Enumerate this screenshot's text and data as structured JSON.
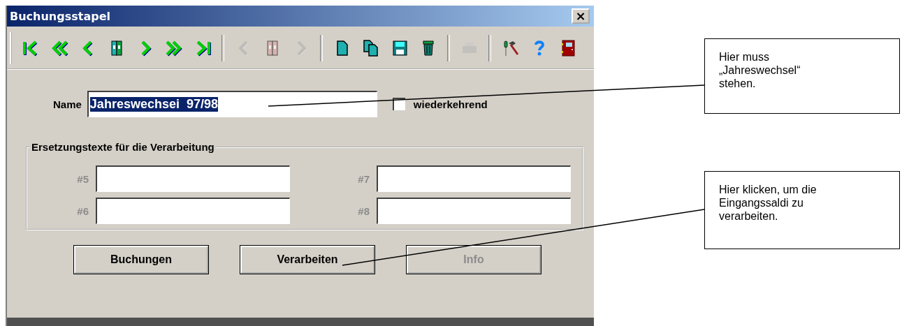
{
  "window": {
    "title": "Buchungsstapel",
    "close": "×"
  },
  "toolbar": [
    {
      "items": [
        {
          "kind": "first",
          "disabled": false
        },
        {
          "kind": "fast-back",
          "disabled": false
        },
        {
          "kind": "back",
          "disabled": false
        },
        {
          "kind": "binder",
          "disabled": false
        },
        {
          "kind": "forward",
          "disabled": false
        },
        {
          "kind": "fast-forward",
          "disabled": false
        },
        {
          "kind": "last",
          "disabled": false
        }
      ]
    },
    {
      "items": [
        {
          "kind": "back",
          "disabled": true
        },
        {
          "kind": "binder",
          "disabled": true
        },
        {
          "kind": "forward",
          "disabled": true
        }
      ]
    },
    {
      "items": [
        {
          "kind": "new",
          "disabled": false
        },
        {
          "kind": "copy",
          "disabled": false
        },
        {
          "kind": "save",
          "disabled": false
        },
        {
          "kind": "trash",
          "disabled": false
        }
      ]
    },
    {
      "items": [
        {
          "kind": "print",
          "disabled": true
        }
      ]
    },
    {
      "items": [
        {
          "kind": "tools",
          "disabled": false
        },
        {
          "kind": "help",
          "disabled": false
        },
        {
          "kind": "exit",
          "disabled": false
        }
      ]
    }
  ],
  "name_field": {
    "label": "Name",
    "value": "Jahreswechsei  97/98",
    "text_selected": true
  },
  "recurring": {
    "label": "wiederkehrend",
    "checked": false
  },
  "replacement_texts": {
    "title": "Ersetzungstexte für die Verarbeitung",
    "fields": [
      {
        "label": "#5",
        "disabled": true
      },
      {
        "label": "#7",
        "disabled": true
      },
      {
        "label": "#6",
        "disabled": true
      },
      {
        "label": "#8",
        "disabled": true
      }
    ]
  },
  "buttons": [
    {
      "label": "Buchungen",
      "disabled": false
    },
    {
      "label": "Verarbeiten",
      "disabled": false
    },
    {
      "label": "Info",
      "disabled": true
    }
  ],
  "callouts": [
    {
      "text": "Hier muss „Jahreswechsel“ stehen."
    },
    {
      "text": "Hier klicken, um die Eingangssaldi zu verarbeiten."
    }
  ]
}
